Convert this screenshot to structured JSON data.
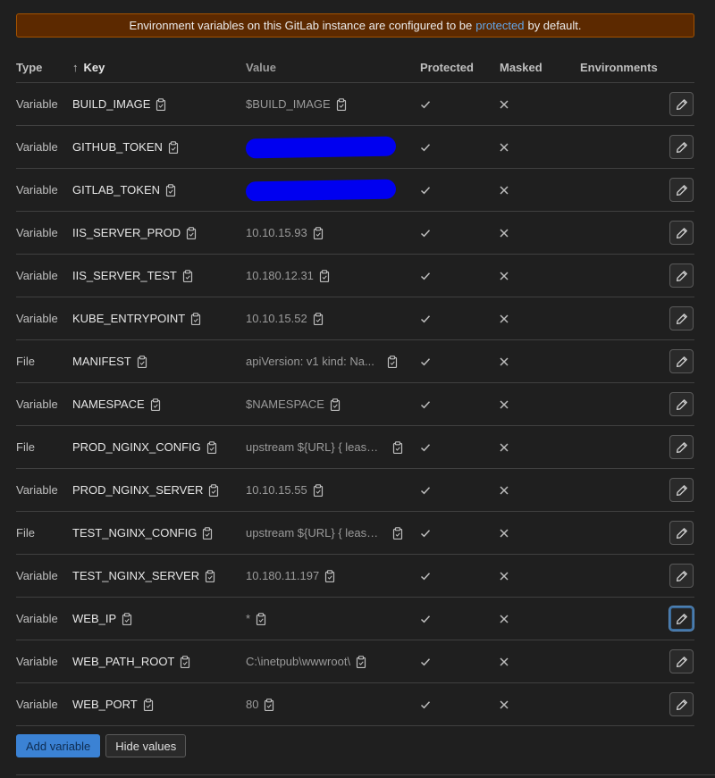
{
  "alert": {
    "prefix": "Environment variables on this GitLab instance are configured to be",
    "link": "protected",
    "suffix": "by default."
  },
  "table": {
    "headers": {
      "type": "Type",
      "key": "Key",
      "value": "Value",
      "protected": "Protected",
      "masked": "Masked",
      "environments": "Environments"
    },
    "rows": [
      {
        "type": "Variable",
        "key": "BUILD_IMAGE",
        "value": "$BUILD_IMAGE",
        "hidden": false,
        "truncated": false
      },
      {
        "type": "Variable",
        "key": "GITHUB_TOKEN",
        "value": "",
        "hidden": true,
        "truncated": false
      },
      {
        "type": "Variable",
        "key": "GITLAB_TOKEN",
        "value": "",
        "hidden": true,
        "truncated": false
      },
      {
        "type": "Variable",
        "key": "IIS_SERVER_PROD",
        "value": "10.10.15.93",
        "hidden": false,
        "truncated": false
      },
      {
        "type": "Variable",
        "key": "IIS_SERVER_TEST",
        "value": "10.180.12.31",
        "hidden": false,
        "truncated": false
      },
      {
        "type": "Variable",
        "key": "KUBE_ENTRYPOINT",
        "value": "10.10.15.52",
        "hidden": false,
        "truncated": false
      },
      {
        "type": "File",
        "key": "MANIFEST",
        "value": "apiVersion: v1 kind: Na...",
        "hidden": false,
        "truncated": true
      },
      {
        "type": "Variable",
        "key": "NAMESPACE",
        "value": "$NAMESPACE",
        "hidden": false,
        "truncated": false
      },
      {
        "type": "File",
        "key": "PROD_NGINX_CONFIG",
        "value": "upstream ${URL} { least_...",
        "hidden": false,
        "truncated": true
      },
      {
        "type": "Variable",
        "key": "PROD_NGINX_SERVER",
        "value": "10.10.15.55",
        "hidden": false,
        "truncated": false
      },
      {
        "type": "File",
        "key": "TEST_NGINX_CONFIG",
        "value": "upstream ${URL} { least_...",
        "hidden": false,
        "truncated": true
      },
      {
        "type": "Variable",
        "key": "TEST_NGINX_SERVER",
        "value": "10.180.11.197",
        "hidden": false,
        "truncated": false
      },
      {
        "type": "Variable",
        "key": "WEB_IP",
        "value": "*",
        "hidden": false,
        "truncated": false,
        "focused": true
      },
      {
        "type": "Variable",
        "key": "WEB_PATH_ROOT",
        "value": "C:\\inetpub\\wwwroot\\",
        "hidden": false,
        "truncated": false
      },
      {
        "type": "Variable",
        "key": "WEB_PORT",
        "value": "80",
        "hidden": false,
        "truncated": false
      }
    ]
  },
  "buttons": {
    "add_variable": "Add variable",
    "hide_values": "Hide values"
  },
  "icons": {
    "sort": "arrow-up-icon",
    "copy": "clipboard-icon",
    "protected": "check-icon",
    "masked": "close-icon",
    "edit": "pencil-icon"
  },
  "colors": {
    "background": "#1f1f1f",
    "alert_bg": "#5c2900",
    "alert_border": "#a35200",
    "link": "#63a6e9",
    "primary": "#3b82d4",
    "redaction": "#0000f0"
  }
}
